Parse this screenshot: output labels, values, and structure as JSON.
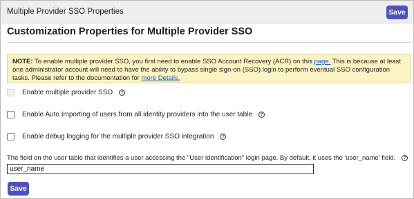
{
  "header": {
    "title": "Multiple Provider SSO Properties",
    "save_label": "Save"
  },
  "main": {
    "heading": "Customization Properties for Multiple Provider SSO",
    "note": {
      "label": "NOTE:",
      "text_before_link": " To enable multiple provider SSO, you first need to enable SSO Account Recovery (ACR) on this ",
      "link1": "page.",
      "text_after_link": "  This is because at least one administrator account will need to have the ability to bypass single sign-on (SSO) login to perform eventual SSO configuration tasks. Please refer to the documentation for ",
      "link2": "more Details."
    },
    "options": [
      {
        "label": "Enable multiple provider SSO",
        "checked": false,
        "disabled": true
      },
      {
        "label": "Enable Auto Importing of users from all identity providers into the user table",
        "checked": false,
        "disabled": false
      },
      {
        "label": "Enable debug logging for the multiple provider SSO integration",
        "checked": false,
        "disabled": false
      }
    ],
    "user_field": {
      "label": "The field on the user table that identifies a user accessing the \"User identification\" login page. By default, it uses the 'user_name' field.",
      "value": "user_name"
    },
    "help_icon": "?",
    "save_label": "Save"
  }
}
